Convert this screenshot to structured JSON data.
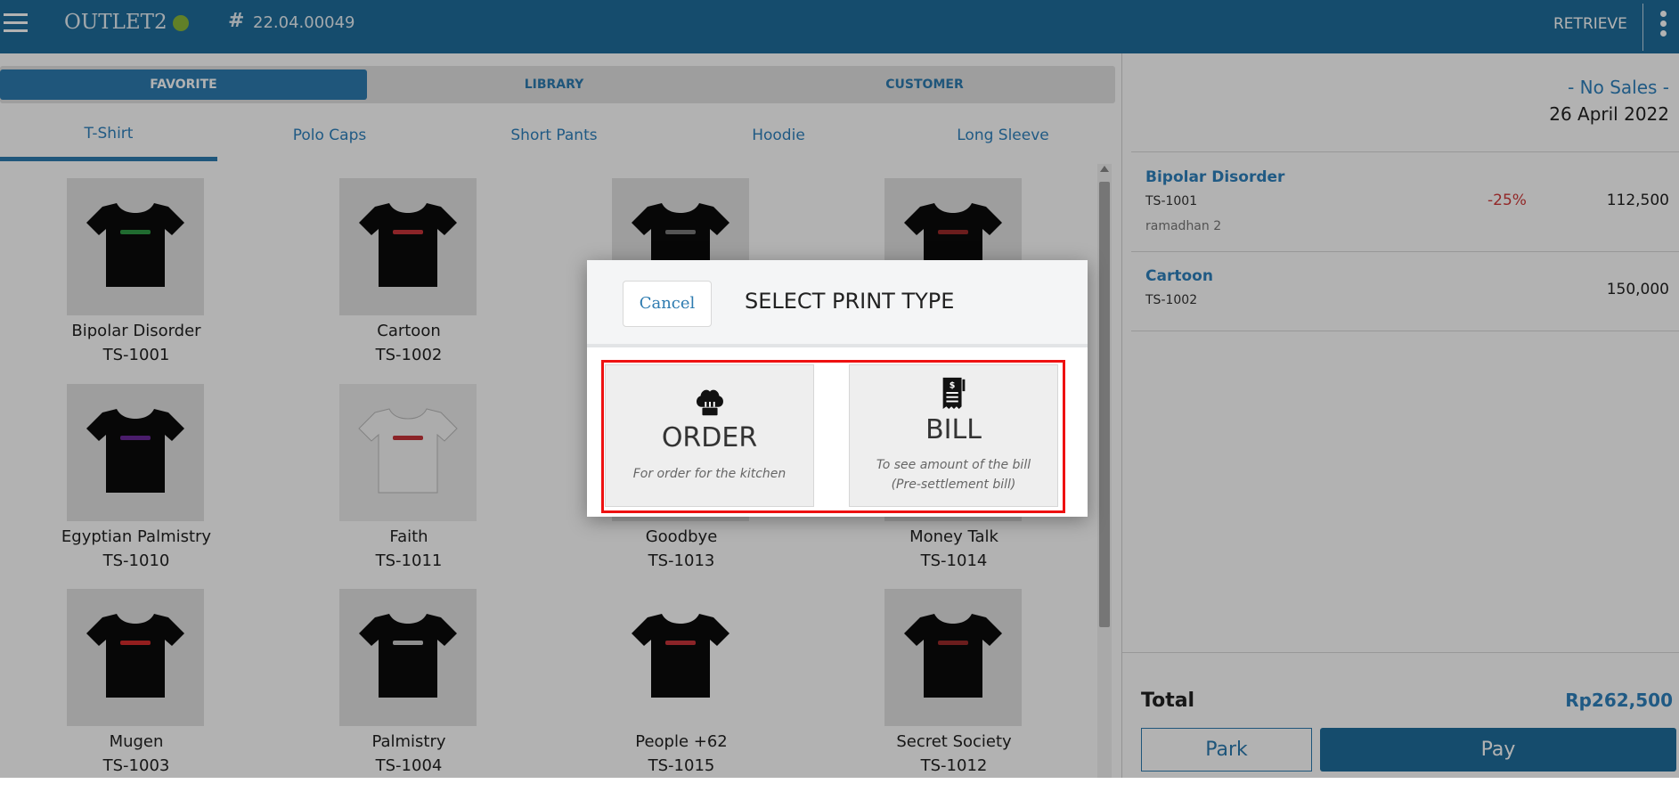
{
  "header": {
    "outlet_name": "OUTLET2",
    "hash_symbol": "#",
    "order_number": "22.04.00049",
    "retrieve_label": "RETRIEVE"
  },
  "tabs": [
    {
      "label": "FAVORITE"
    },
    {
      "label": "LIBRARY"
    },
    {
      "label": "CUSTOMER"
    }
  ],
  "categories": [
    {
      "label": "T-Shirt"
    },
    {
      "label": "Polo Caps"
    },
    {
      "label": "Short Pants"
    },
    {
      "label": "Hoodie"
    },
    {
      "label": "Long Sleeve"
    }
  ],
  "products": [
    {
      "name": "Bipolar Disorder",
      "code": "TS-1001",
      "print_color": "#2e9a45"
    },
    {
      "name": "Cartoon",
      "code": "TS-1002",
      "print_color": "#c8343a"
    },
    {
      "name": "",
      "code": "",
      "print_color": "#7a7a7a"
    },
    {
      "name": "",
      "code": "",
      "print_color": "#9a2a2a"
    },
    {
      "name": "Egyptian Palmistry",
      "code": "TS-1010",
      "print_color": "#6a2a9a"
    },
    {
      "name": "Faith",
      "code": "TS-1011",
      "print_color": "#c8343a"
    },
    {
      "name": "Goodbye",
      "code": "TS-1013",
      "print_color": "#7a7a7a"
    },
    {
      "name": "Money Talk",
      "code": "TS-1014",
      "print_color": "#9a2a2a"
    },
    {
      "name": "Mugen",
      "code": "TS-1003",
      "print_color": "#d42b2b"
    },
    {
      "name": "Palmistry",
      "code": "TS-1004",
      "print_color": "#cccccc"
    },
    {
      "name": "People +62",
      "code": "TS-1015",
      "print_color": "#c8343a"
    },
    {
      "name": "Secret Society",
      "code": "TS-1012",
      "print_color": "#9a2a2a"
    }
  ],
  "cart": {
    "status": "- No Sales -",
    "date": "26 April 2022",
    "items": [
      {
        "name": "Bipolar Disorder",
        "code": "TS-1001",
        "note": "ramadhan 2",
        "discount": "-25%",
        "price": "112,500"
      },
      {
        "name": "Cartoon",
        "code": "TS-1002",
        "note": "",
        "discount": "",
        "price": "150,000"
      }
    ],
    "total_label": "Total",
    "total_value": "Rp262,500",
    "park_label": "Park",
    "pay_label": "Pay"
  },
  "modal": {
    "cancel_label": "Cancel",
    "title": "SELECT PRINT TYPE",
    "options": [
      {
        "title": "ORDER",
        "description": "For order for the kitchen",
        "icon": "chef-hat-icon"
      },
      {
        "title": "BILL",
        "description_line1": "To see amount of the bill",
        "description_line2": "(Pre-settlement bill)",
        "icon": "receipt-icon"
      }
    ]
  },
  "colors": {
    "primary": "#1f6e9c",
    "accent": "#2f82be",
    "discount": "#d13a3a",
    "highlight": "#ee1111",
    "status_dot": "#8bb83a"
  }
}
